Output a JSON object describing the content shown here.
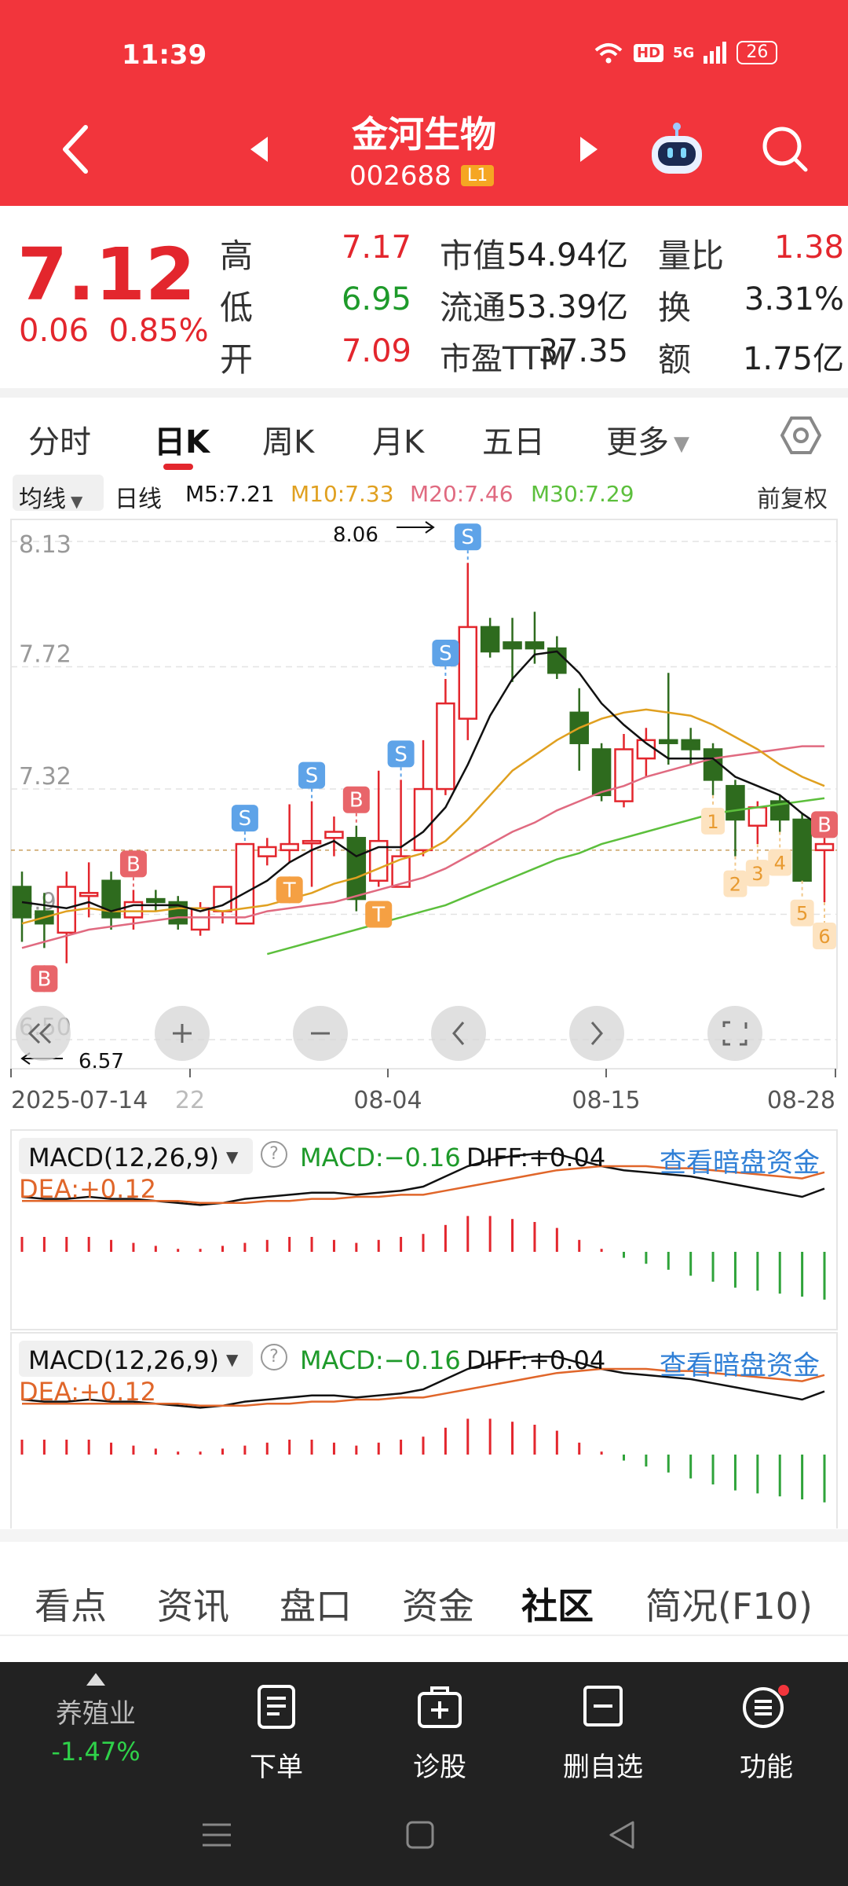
{
  "status": {
    "time": "11:39",
    "hd": "HD",
    "signal": "5G",
    "battery": "26"
  },
  "header": {
    "name": "金河生物",
    "code": "002688",
    "tag": "L1"
  },
  "quote": {
    "price": "7.12",
    "change": "0.06",
    "change_pct": "0.85%",
    "rows": [
      {
        "l1": "高",
        "v1": "7.17",
        "c1": "red",
        "l2": "市值",
        "v2": "54.94亿",
        "l3": "量比",
        "v3": "1.38",
        "c3": "red"
      },
      {
        "l1": "低",
        "v1": "6.95",
        "c1": "green",
        "l2": "流通",
        "v2": "53.39亿",
        "l3": "换",
        "v3": "3.31%",
        "c3": "dark"
      },
      {
        "l1": "开",
        "v1": "7.09",
        "c1": "red",
        "l2": "市盈TTM",
        "v2": "37.35",
        "l3": "额",
        "v3": "1.75亿",
        "c3": "dark"
      }
    ]
  },
  "ktabs": [
    "分时",
    "日K",
    "周K",
    "月K",
    "五日",
    "更多"
  ],
  "ma": {
    "select": "均线",
    "period": "日线",
    "m5": "M5:7.21",
    "m10": "M10:7.33",
    "m20": "M20:7.46",
    "m30": "M30:7.29",
    "adjust": "前复权"
  },
  "chart_data": {
    "type": "candlestick",
    "y_ticks": [
      "8.13",
      "7.72",
      "7.32",
      "6.91",
      "6.50"
    ],
    "ylim": [
      6.5,
      8.13
    ],
    "high_label": "8.06",
    "low_label": "6.57",
    "x_ticks": [
      "2025-07-14",
      "22",
      "08-04",
      "08-15",
      "08-28"
    ],
    "last_close": 7.12,
    "candles": [
      [
        7.0,
        6.9,
        7.05,
        6.82
      ],
      [
        6.92,
        6.88,
        6.98,
        6.8
      ],
      [
        6.85,
        7.0,
        7.05,
        6.75
      ],
      [
        6.97,
        6.98,
        7.08,
        6.9
      ],
      [
        7.02,
        6.9,
        7.05,
        6.86
      ],
      [
        6.9,
        6.95,
        6.99,
        6.86
      ],
      [
        6.96,
        6.95,
        6.99,
        6.92
      ],
      [
        6.95,
        6.88,
        6.97,
        6.86
      ],
      [
        6.86,
        6.93,
        6.95,
        6.84
      ],
      [
        6.92,
        7.0,
        7.0,
        6.88
      ],
      [
        6.88,
        7.14,
        7.14,
        6.88
      ],
      [
        7.1,
        7.13,
        7.16,
        7.07
      ],
      [
        7.12,
        7.14,
        7.27,
        7.08
      ],
      [
        7.15,
        7.15,
        7.28,
        7.0
      ],
      [
        7.16,
        7.18,
        7.23,
        7.1
      ],
      [
        7.16,
        6.96,
        7.2,
        6.92
      ],
      [
        7.02,
        7.15,
        7.38,
        7.0
      ],
      [
        7.0,
        7.1,
        7.35,
        7.0
      ],
      [
        7.12,
        7.32,
        7.48,
        7.1
      ],
      [
        7.32,
        7.6,
        7.68,
        7.3
      ],
      [
        7.55,
        7.85,
        8.06,
        7.48
      ],
      [
        7.85,
        7.77,
        7.88,
        7.75
      ],
      [
        7.8,
        7.78,
        7.88,
        7.67
      ],
      [
        7.8,
        7.78,
        7.9,
        7.73
      ],
      [
        7.78,
        7.7,
        7.82,
        7.68
      ],
      [
        7.57,
        7.47,
        7.65,
        7.38
      ],
      [
        7.45,
        7.3,
        7.47,
        7.28
      ],
      [
        7.28,
        7.45,
        7.5,
        7.26
      ],
      [
        7.42,
        7.48,
        7.52,
        7.36
      ],
      [
        7.48,
        7.47,
        7.7,
        7.4
      ],
      [
        7.48,
        7.45,
        7.52,
        7.4
      ],
      [
        7.45,
        7.35,
        7.47,
        7.3
      ],
      [
        7.33,
        7.22,
        7.35,
        7.1
      ],
      [
        7.2,
        7.26,
        7.28,
        7.14
      ],
      [
        7.28,
        7.22,
        7.3,
        7.18
      ],
      [
        7.22,
        7.02,
        7.24,
        7.02
      ],
      [
        7.12,
        7.14,
        7.17,
        6.95
      ]
    ],
    "ma5": [
      6.95,
      6.94,
      6.93,
      6.95,
      6.92,
      6.94,
      6.94,
      6.94,
      6.92,
      6.94,
      6.98,
      7.02,
      7.08,
      7.12,
      7.15,
      7.1,
      7.13,
      7.13,
      7.18,
      7.26,
      7.4,
      7.56,
      7.68,
      7.76,
      7.77,
      7.7,
      7.6,
      7.53,
      7.47,
      7.42,
      7.42,
      7.42,
      7.36,
      7.33,
      7.3,
      7.24,
      7.19
    ],
    "ma10": [
      6.88,
      6.9,
      6.92,
      6.93,
      6.92,
      6.92,
      6.92,
      6.93,
      6.93,
      6.92,
      6.93,
      6.94,
      6.96,
      6.98,
      7.01,
      7.03,
      7.06,
      7.09,
      7.11,
      7.15,
      7.22,
      7.3,
      7.38,
      7.43,
      7.48,
      7.52,
      7.55,
      7.57,
      7.58,
      7.57,
      7.56,
      7.53,
      7.49,
      7.45,
      7.4,
      7.36,
      7.33
    ],
    "ma20": [
      6.8,
      6.82,
      6.84,
      6.86,
      6.87,
      6.88,
      6.89,
      6.9,
      6.9,
      6.9,
      6.9,
      6.92,
      6.93,
      6.94,
      6.95,
      6.97,
      6.99,
      7.01,
      7.03,
      7.06,
      7.1,
      7.14,
      7.18,
      7.21,
      7.25,
      7.28,
      7.31,
      7.33,
      7.36,
      7.38,
      7.4,
      7.42,
      7.43,
      7.44,
      7.45,
      7.46,
      7.46
    ],
    "ma30": [
      null,
      null,
      null,
      null,
      null,
      null,
      null,
      null,
      null,
      null,
      null,
      6.78,
      6.8,
      6.82,
      6.84,
      6.86,
      6.88,
      6.9,
      6.92,
      6.94,
      6.97,
      7.0,
      7.03,
      7.06,
      7.09,
      7.11,
      7.14,
      7.16,
      7.18,
      7.2,
      7.22,
      7.24,
      7.25,
      7.26,
      7.27,
      7.28,
      7.29
    ],
    "markers": [
      {
        "i": 1,
        "label": "B"
      },
      {
        "i": 5,
        "label": "B"
      },
      {
        "i": 10,
        "label": "S"
      },
      {
        "i": 12,
        "label": "T"
      },
      {
        "i": 13,
        "label": "S"
      },
      {
        "i": 15,
        "label": "B"
      },
      {
        "i": 16,
        "label": "T"
      },
      {
        "i": 17,
        "label": "S"
      },
      {
        "i": 19,
        "label": "S"
      },
      {
        "i": 20,
        "label": "S"
      },
      {
        "i": 36,
        "label": "B"
      }
    ],
    "number_marks": [
      {
        "i": 31,
        "label": "1"
      },
      {
        "i": 32,
        "label": "2"
      },
      {
        "i": 33,
        "label": "3"
      },
      {
        "i": 34,
        "label": "4"
      },
      {
        "i": 35,
        "label": "5"
      },
      {
        "i": 36,
        "label": "6"
      }
    ],
    "macd": [
      0.05,
      0.05,
      0.05,
      0.05,
      0.04,
      0.03,
      0.02,
      0.01,
      0.01,
      0.02,
      0.03,
      0.04,
      0.05,
      0.05,
      0.04,
      0.03,
      0.04,
      0.05,
      0.06,
      0.09,
      0.12,
      0.12,
      0.11,
      0.1,
      0.08,
      0.04,
      0.01,
      -0.02,
      -0.04,
      -0.06,
      -0.08,
      -0.1,
      -0.12,
      -0.13,
      -0.14,
      -0.15,
      -0.16
    ],
    "diff": [
      0.0,
      -0.01,
      -0.01,
      0.0,
      -0.01,
      -0.01,
      -0.02,
      -0.03,
      -0.04,
      -0.03,
      -0.01,
      0.0,
      0.01,
      0.02,
      0.02,
      0.01,
      0.02,
      0.03,
      0.05,
      0.1,
      0.15,
      0.18,
      0.2,
      0.21,
      0.21,
      0.18,
      0.15,
      0.13,
      0.12,
      0.11,
      0.1,
      0.08,
      0.06,
      0.04,
      0.02,
      0.0,
      0.04
    ],
    "dea": [
      -0.02,
      -0.02,
      -0.02,
      -0.02,
      -0.02,
      -0.02,
      -0.02,
      -0.02,
      -0.03,
      -0.03,
      -0.03,
      -0.02,
      -0.02,
      -0.01,
      -0.01,
      0.0,
      0.0,
      0.01,
      0.01,
      0.03,
      0.05,
      0.07,
      0.09,
      0.11,
      0.13,
      0.14,
      0.15,
      0.15,
      0.15,
      0.14,
      0.14,
      0.13,
      0.12,
      0.11,
      0.1,
      0.09,
      0.12
    ]
  },
  "macd_panel": {
    "title": "MACD(12,26,9)",
    "macd": "MACD:−0.16",
    "diff": "DIFF:+0.04",
    "dea": "DEA:+0.12",
    "link": "查看暗盘资金"
  },
  "bottom_tabs": [
    "看点",
    "资讯",
    "盘口",
    "资金",
    "社区",
    "简况(F10)"
  ],
  "nav": {
    "sector": "养殖业",
    "sector_pct": "-1.47%",
    "items": [
      "下单",
      "诊股",
      "删自选",
      "功能"
    ]
  },
  "colors": {
    "header": "#f2353c",
    "up": "#e3262d",
    "down": "#2e6b1e",
    "ma5": "#111111",
    "ma10": "#e0a020",
    "ma20": "#e06a80",
    "ma30": "#5cbf3c"
  }
}
